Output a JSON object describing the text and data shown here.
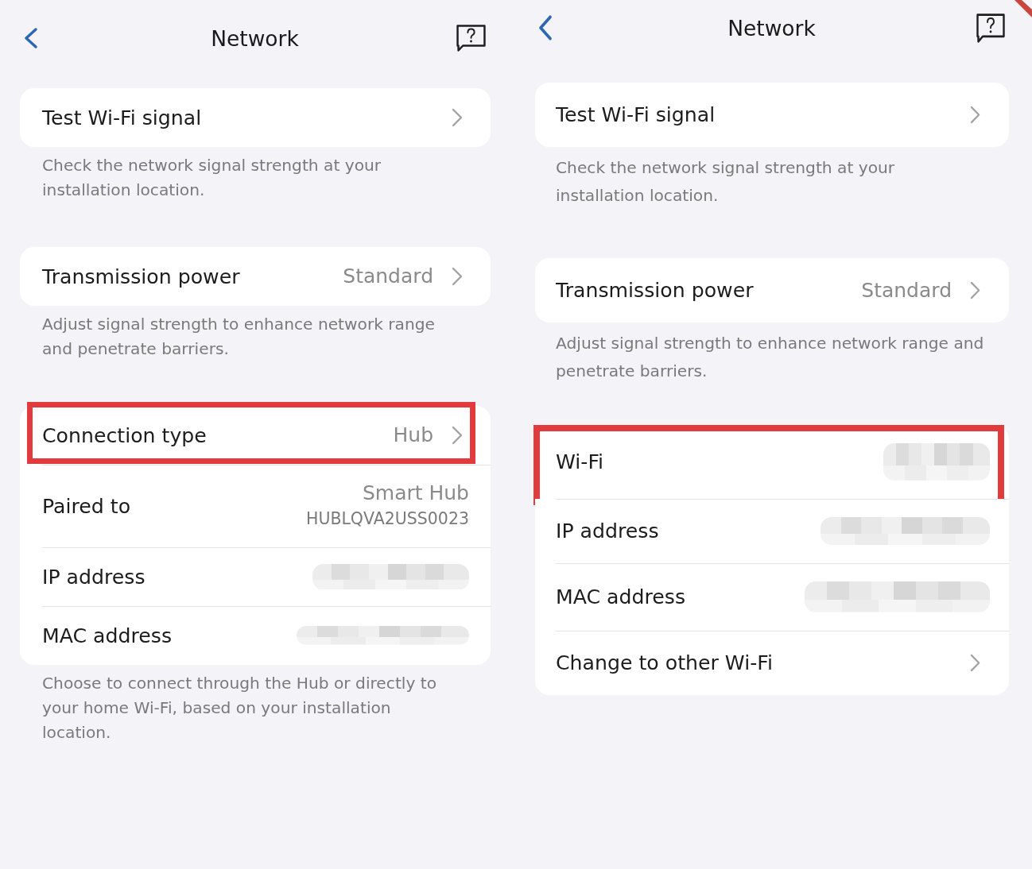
{
  "panels": [
    {
      "header": {
        "title": "Network"
      },
      "sections": [
        {
          "rows": [
            {
              "kind": "nav",
              "label": "Test Wi-Fi signal",
              "value_hidden": false,
              "highlighted": false
            }
          ],
          "note": "Check the network signal strength at your installation location."
        },
        {
          "rows": [
            {
              "kind": "nav",
              "label": "Transmission power",
              "value": "Standard",
              "value_hidden": false,
              "highlighted": false
            }
          ],
          "note": "Adjust signal strength to enhance network range and penetrate barriers."
        },
        {
          "rows": [
            {
              "kind": "nav",
              "label": "Connection type",
              "value": "Hub",
              "value_hidden": false,
              "highlighted": true
            },
            {
              "kind": "info",
              "label": "Paired to",
              "value": "Smart Hub",
              "subvalue": "HUBLQVA2USS0023",
              "value_hidden": false,
              "highlighted": false
            },
            {
              "kind": "info",
              "label": "IP address",
              "value_hidden": true,
              "highlighted": false
            },
            {
              "kind": "info",
              "label": "MAC address",
              "value_hidden": true,
              "highlighted": false
            }
          ],
          "note": "Choose to connect through the Hub or directly to your home Wi-Fi, based on your installation location."
        }
      ]
    },
    {
      "header": {
        "title": "Network"
      },
      "sections": [
        {
          "rows": [
            {
              "kind": "nav",
              "label": "Test Wi-Fi signal",
              "value_hidden": false,
              "highlighted": false
            }
          ],
          "note": "Check the network signal strength at your installation location."
        },
        {
          "rows": [
            {
              "kind": "nav",
              "label": "Transmission power",
              "value": "Standard",
              "value_hidden": false,
              "highlighted": false
            }
          ],
          "note": "Adjust signal strength to enhance network range and penetrate barriers."
        },
        {
          "rows": [
            {
              "kind": "info",
              "label": "Wi-Fi",
              "value_hidden": true,
              "highlighted": true
            },
            {
              "kind": "info",
              "label": "IP address",
              "value_hidden": true,
              "highlighted": false
            },
            {
              "kind": "info",
              "label": "MAC address",
              "value_hidden": true,
              "highlighted": false
            },
            {
              "kind": "nav",
              "label": "Change to other Wi-Fi",
              "value_hidden": false,
              "highlighted": false
            }
          ]
        }
      ]
    }
  ]
}
